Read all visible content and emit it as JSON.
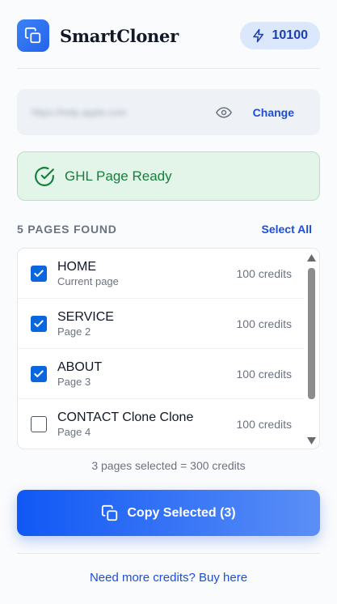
{
  "header": {
    "app_name": "SmartCloner",
    "credits": "10100"
  },
  "url_box": {
    "url": "https://help.apple.com",
    "change_label": "Change"
  },
  "status": {
    "text": "GHL Page Ready"
  },
  "pages": {
    "title": "5 PAGES FOUND",
    "select_all_label": "Select All",
    "items": [
      {
        "name": "HOME",
        "sub": "Current page",
        "credits": "100 credits",
        "checked": true
      },
      {
        "name": "SERVICE",
        "sub": "Page 2",
        "credits": "100 credits",
        "checked": true
      },
      {
        "name": "ABOUT",
        "sub": "Page 3",
        "credits": "100 credits",
        "checked": true
      },
      {
        "name": "CONTACT Clone Clone",
        "sub": "Page 4",
        "credits": "100 credits",
        "checked": false
      }
    ]
  },
  "summary": "3 pages selected = 300 credits",
  "copy_button_label": "Copy Selected (3)",
  "buy_link": "Need more credits? Buy here",
  "colors": {
    "accent": "#1d4ed8",
    "success": "#15803d",
    "checkbox": "#0a66dd"
  }
}
